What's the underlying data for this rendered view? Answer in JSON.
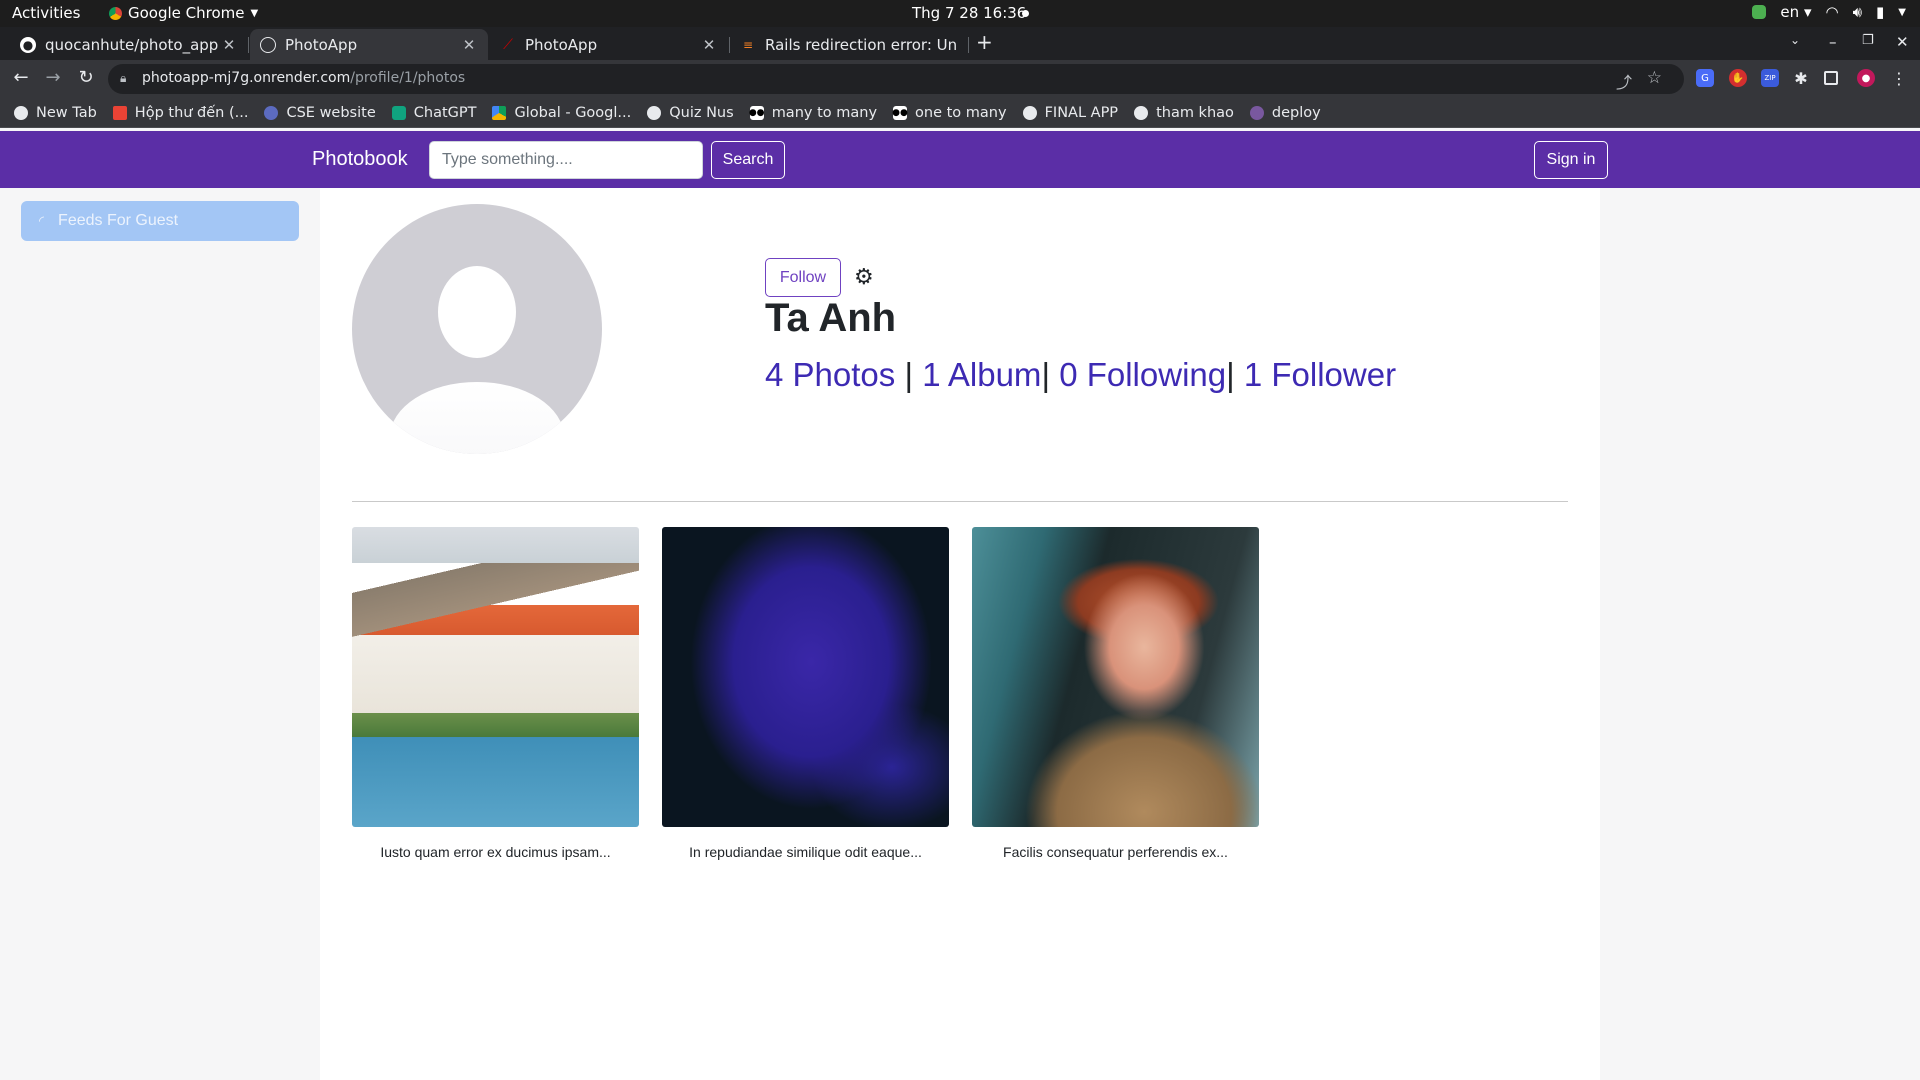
{
  "system_bar": {
    "activities": "Activities",
    "app_name": "Google Chrome",
    "clock": "Thg 7 28  16:36",
    "language": "en"
  },
  "browser": {
    "tabs": [
      {
        "title": "quocanhute/photo_app",
        "icon": "github-icon"
      },
      {
        "title": "PhotoApp",
        "icon": "globe-icon",
        "active": true
      },
      {
        "title": "PhotoApp",
        "icon": "rails-icon"
      },
      {
        "title": "Rails redirection error: Un",
        "icon": "stackoverflow-icon"
      }
    ],
    "url_host": "photoapp-mj7g.onrender.com",
    "url_path": "/profile/1/photos",
    "bookmarks": [
      {
        "label": "New Tab",
        "icon": "globe-icon"
      },
      {
        "label": "Hộp thư đến (...",
        "icon": "gmail-icon"
      },
      {
        "label": "CSE website",
        "icon": "cse-icon"
      },
      {
        "label": "ChatGPT",
        "icon": "chatgpt-icon"
      },
      {
        "label": "Global - Googl...",
        "icon": "drive-icon"
      },
      {
        "label": "Quiz Nus",
        "icon": "globe-icon"
      },
      {
        "label": "many to many",
        "icon": "medium-icon"
      },
      {
        "label": "one to many",
        "icon": "medium-icon"
      },
      {
        "label": "FINAL APP",
        "icon": "globe-icon"
      },
      {
        "label": "tham khao",
        "icon": "github-icon"
      },
      {
        "label": "deploy",
        "icon": "heroku-icon"
      }
    ]
  },
  "app": {
    "brand": "Photobook",
    "search_placeholder": "Type something....",
    "search_label": "Search",
    "signin_label": "Sign in",
    "sidebar": {
      "feeds_label": "Feeds For Guest"
    },
    "profile": {
      "follow_label": "Follow",
      "name": "Ta Anh",
      "photos": "4 Photos",
      "albums": "1 Album",
      "following": "0 Following",
      "followers": "1 Follower"
    },
    "photos": [
      {
        "caption": "Iusto quam error ex ducimus ipsam..."
      },
      {
        "caption": "In repudiandae similique odit eaque..."
      },
      {
        "caption": "Facilis consequatur perferendis ex..."
      }
    ]
  },
  "colors": {
    "navbar": "#5b2ea6",
    "sidebar_active": "#a3c6f5",
    "stats_link": "#3d2ab3"
  }
}
